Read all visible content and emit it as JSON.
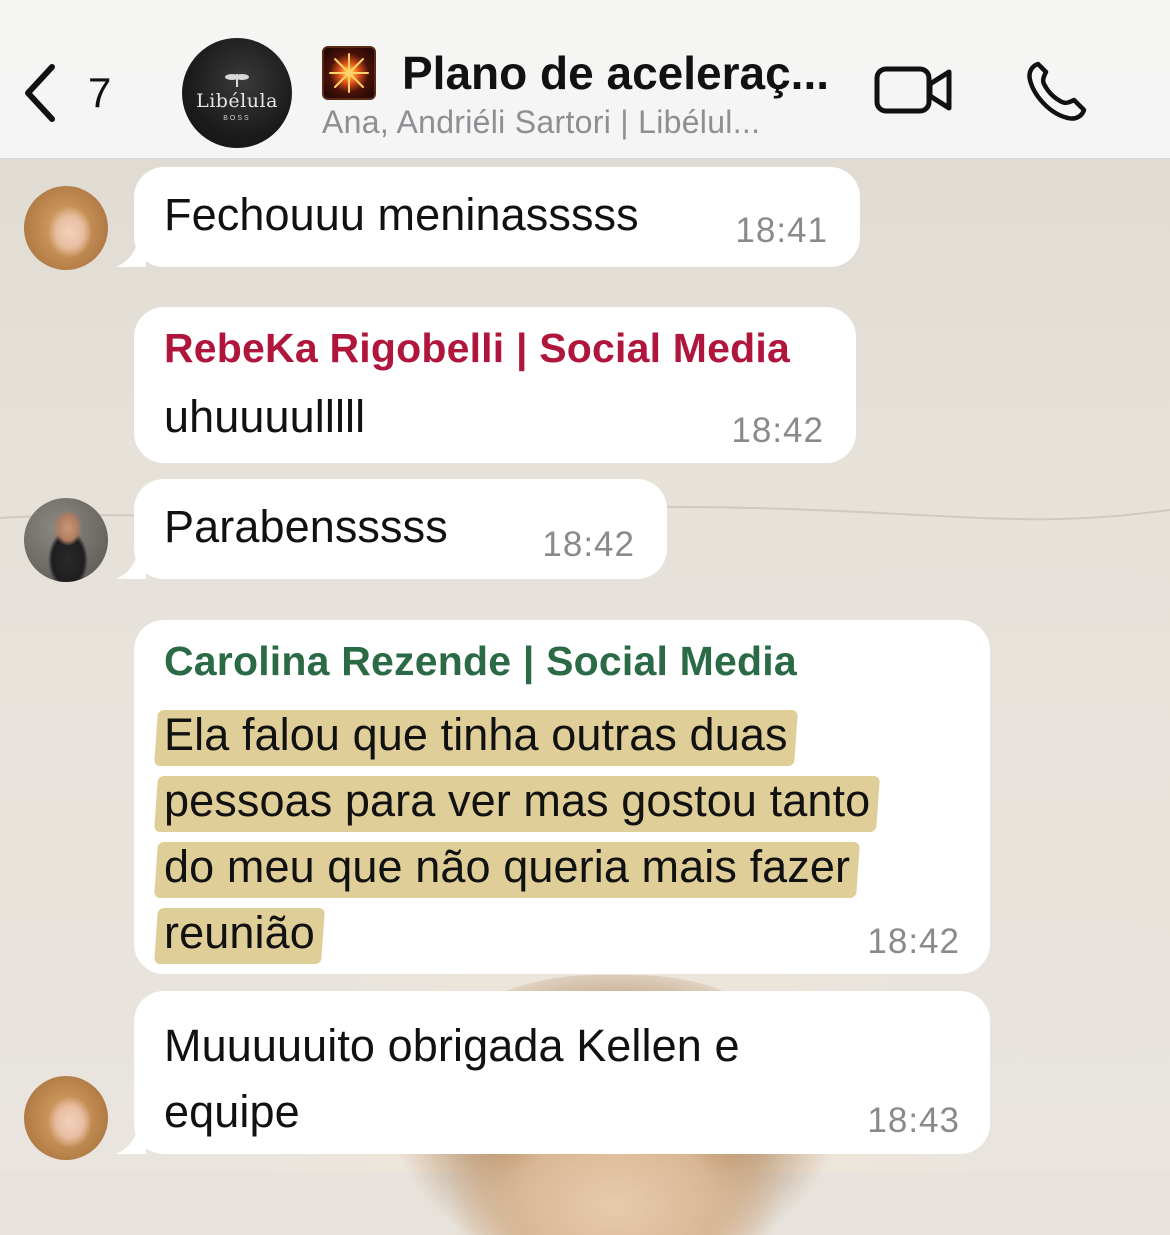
{
  "header": {
    "back_count": "7",
    "group_title": "Plano de aceleraç...",
    "group_members": "Ana, Andriéli Sartori | Libélul...",
    "group_avatar_text": "Libélula",
    "group_avatar_subtext": "BOSS"
  },
  "messages": [
    {
      "text": "Fechouuu meninasssss",
      "time": "18:41"
    },
    {
      "sender": "RebeKa Rigobelli | Social Media",
      "sender_color": "#b0163c",
      "text": "uhuuuulllll",
      "time": "18:42"
    },
    {
      "text": "Parabensssss",
      "time": "18:42"
    },
    {
      "sender": "Carolina Rezende | Social Media",
      "sender_color": "#2a6a45",
      "lines": [
        "Ela falou que tinha outras duas",
        "pessoas para ver mas gostou tanto",
        "do meu que não queria mais fazer",
        "reunião"
      ],
      "highlight_color": "#d9c686",
      "time": "18:42"
    },
    {
      "lines": [
        "Muuuuuito obrigada Kellen e",
        "equipe"
      ],
      "time": "18:43"
    }
  ]
}
